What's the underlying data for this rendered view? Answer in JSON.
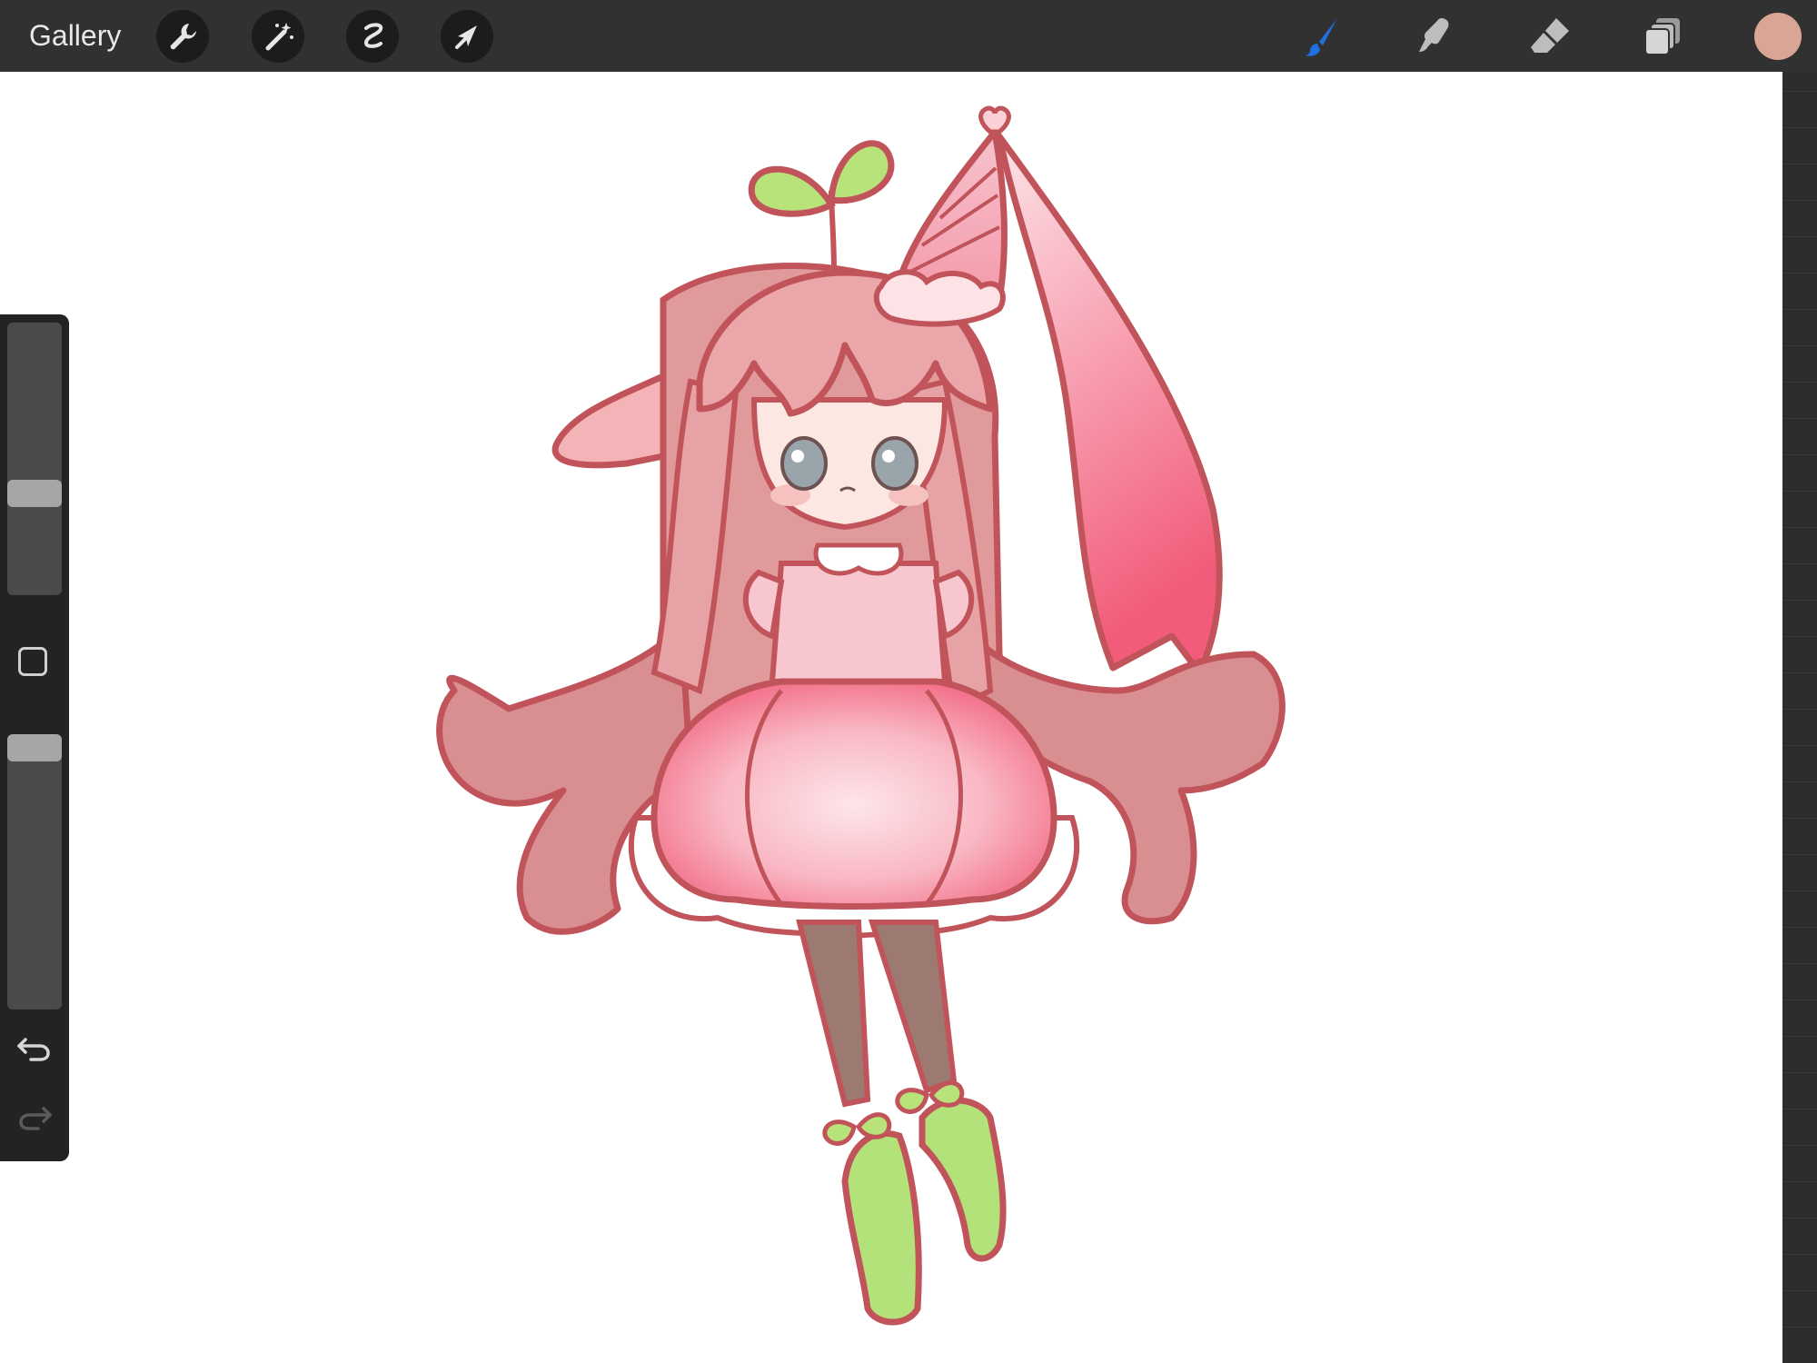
{
  "toolbar": {
    "gallery_label": "Gallery",
    "left_tools": [
      "actions-icon",
      "adjustments-icon",
      "selection-icon",
      "transform-icon"
    ],
    "right_tools": [
      "brush-icon",
      "smudge-icon",
      "eraser-icon",
      "layers-icon"
    ],
    "active_tool": "brush",
    "active_tool_color": "#1f6fe0",
    "current_color": "#d9a594"
  },
  "sidebar": {
    "brush_size_level": 0.36,
    "opacity_level": 1.0,
    "undo_icon": "undo-icon",
    "redo_icon": "redo-icon"
  },
  "canvas": {
    "background": "#ffffff",
    "artwork": "drawing-of-girl-with-sprout-and-party-hat"
  }
}
